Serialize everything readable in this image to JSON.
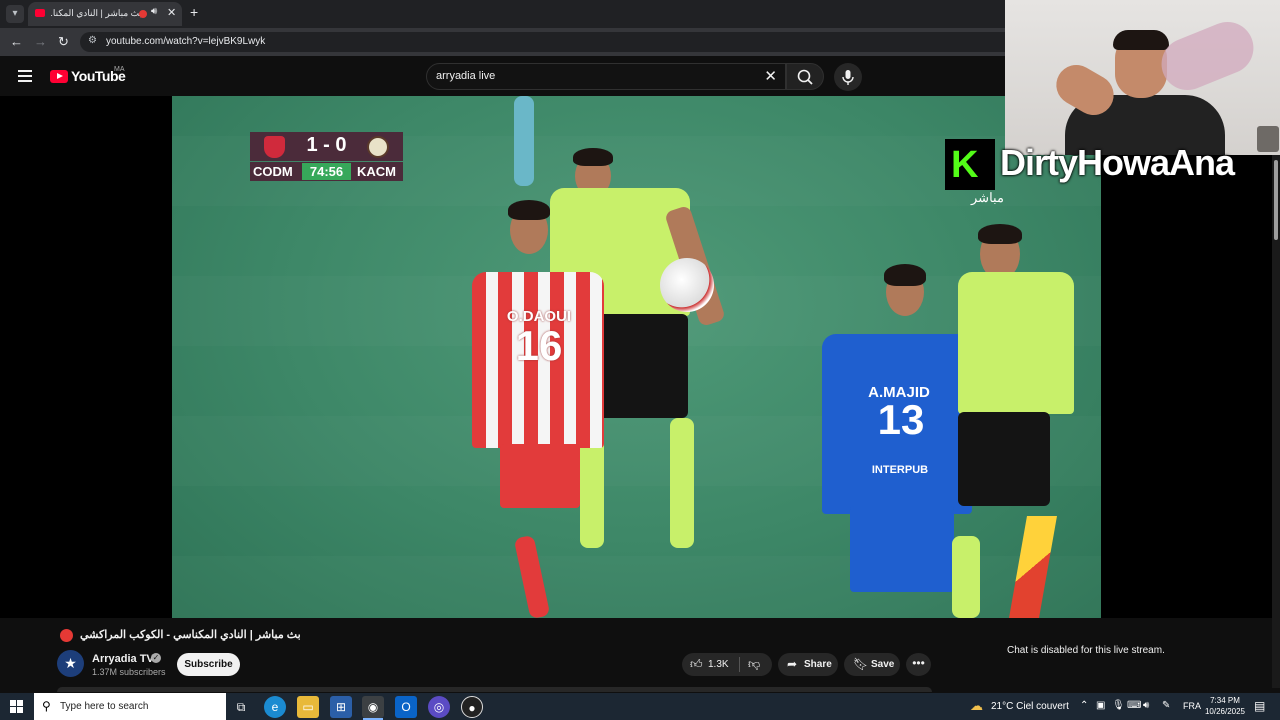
{
  "browser": {
    "tab_title": "بث مباشر | النادي المكنا...",
    "url": "youtube.com/watch?v=lejvBK9Lwyk",
    "tab_menu_icon": "chevron-down-icon",
    "new_tab_icon": "plus-icon"
  },
  "youtube": {
    "logo_text": "YouTube",
    "country_code": "MA",
    "search_value": "arryadia live",
    "search_placeholder": "Search"
  },
  "scoreboard": {
    "score": "1 - 0",
    "home": "CODM",
    "away": "KACM",
    "clock": "74:56"
  },
  "players": {
    "red": {
      "name": "O.DAOUI",
      "number": "16"
    },
    "blue": {
      "name": "A.MAJID",
      "number": "13",
      "sponsor": "INTERPUB"
    }
  },
  "overlay": {
    "kick_letter": "K",
    "streamer_name": "DirtyHowaAna",
    "live_label": "مباشر"
  },
  "video_info": {
    "title": "بث مباشر | النادي المكناسي - الكوكب المراكشي",
    "channel_name": "Arryadia TV",
    "channel_avatar_glyph": "★",
    "subscribers": "1.37M subscribers",
    "subscribe_label": "Subscribe",
    "like_count": "1.3K",
    "share_label": "Share",
    "save_label": "Save",
    "chat_disabled": "Chat is disabled for this live stream."
  },
  "taskbar": {
    "search_placeholder": "Type here to search",
    "weather": "21°C  Ciel couvert",
    "language": "FRA",
    "time": "7:34 PM",
    "date": "10/26/2025"
  },
  "colors": {
    "youtube_red": "#ff0033",
    "pitch_green": "#3d8767",
    "scoreboard_bg": "#4b2b3a",
    "clock_green": "#37a85a",
    "kick_green": "#53fc18"
  }
}
